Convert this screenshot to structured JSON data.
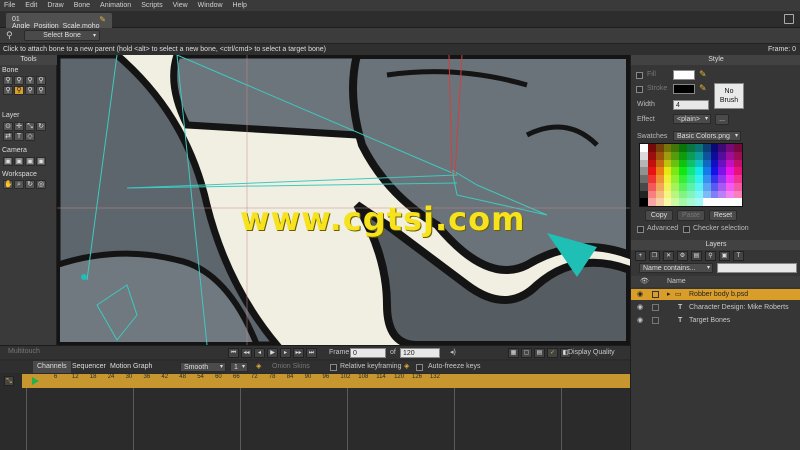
{
  "menu": [
    "File",
    "Edit",
    "Draw",
    "Bone",
    "Animation",
    "Scripts",
    "View",
    "Window",
    "Help"
  ],
  "document_tab": "01 Angle_Position_Scale.moho",
  "tool_options": {
    "select_bone": "Select Bone"
  },
  "status": {
    "message": "Click to attach bone to a new parent (hold <alt> to select a new bone, <ctrl/cmd> to select a target bone)",
    "frame": "Frame: 0"
  },
  "tools": {
    "header": "Tools",
    "sections": [
      "Bone",
      "Layer",
      "Camera",
      "Workspace"
    ]
  },
  "canvas": {
    "watermark": "www.cgtsj.com"
  },
  "style": {
    "header": "Style",
    "fill_label": "Fill",
    "stroke_label": "Stroke",
    "width_label": "Width",
    "width_value": "4",
    "effect_label": "Effect",
    "effect_value": "<plain>",
    "ellipsis": "...",
    "no_brush": "No Brush",
    "swatches_label": "Swatches",
    "swatches_value": "Basic Colors.png",
    "copy": "Copy",
    "paste": "Paste",
    "reset": "Reset",
    "advanced": "Advanced",
    "checker": "Checker selection"
  },
  "layers": {
    "header": "Layers",
    "filter": "Name contains...",
    "name_col": "Name",
    "items": [
      "Robber body b.psd",
      "Character Design: Mike Roberts",
      "Target Bones"
    ]
  },
  "timeline": {
    "multitouch": "Multitouch",
    "frame_label": "Frame",
    "frame_value": "0",
    "of_label": "of",
    "total_frames": "120",
    "display_quality": "Display Quality",
    "tabs": [
      "Channels",
      "Sequencer",
      "Motion Graph"
    ],
    "interp": "Smooth",
    "interp_count": "1",
    "onion": "Onion Skins",
    "relative": "Relative keyframing",
    "autofreeze": "Auto-freeze keys",
    "ruler_ticks": [
      "6",
      "12",
      "18",
      "24",
      "30",
      "36",
      "42",
      "48",
      "54",
      "60",
      "66",
      "72",
      "78",
      "84",
      "90",
      "96",
      "102",
      "108",
      "114",
      "120",
      "126",
      "132"
    ]
  },
  "colors": {
    "accent": "#d99d2a",
    "watermark": "#f7e21e",
    "bone_line": "#3fc9c0"
  }
}
